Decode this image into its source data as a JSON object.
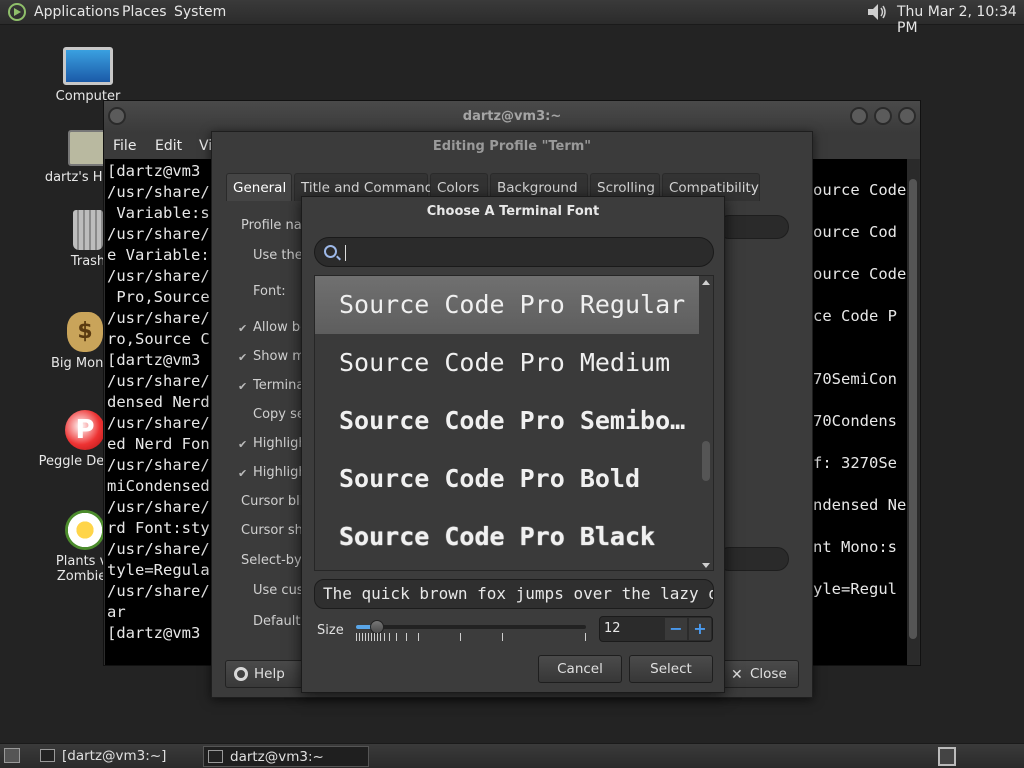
{
  "top_panel": {
    "menus": [
      "Applications",
      "Places",
      "System"
    ],
    "clock": "Thu Mar  2, 10:34 PM"
  },
  "desktop_icons": [
    {
      "label": "Computer",
      "icon": "computer-icon"
    },
    {
      "label": "dartz's Home",
      "icon": "home-folder-icon"
    },
    {
      "label": "Trash",
      "icon": "trash-icon"
    },
    {
      "label": "Big Money",
      "icon": "money-bag-icon"
    },
    {
      "label": "Peggle Deluxe",
      "icon": "peggle-icon"
    },
    {
      "label": "Plants vs Zombies",
      "icon": "plants-icon"
    }
  ],
  "terminal_window": {
    "title": "dartz@vm3:~",
    "menus": [
      "File",
      "Edit",
      "View"
    ],
    "visible_lines": [
      "[dartz@vm3",
      "/usr/share/",
      " Variable:s",
      "/usr/share/",
      "e Variable:",
      "/usr/share/",
      " Pro,Source",
      "/usr/share/",
      "ro,Source C",
      "[dartz@vm3",
      "/usr/share/",
      "densed Nerd",
      "/usr/share/",
      "ed Nerd Fon",
      "/usr/share/",
      "miCondensed",
      "/usr/share/",
      "rd Font:sty",
      "/usr/share/",
      "tyle=Regula",
      "/usr/share/",
      "ar",
      "[dartz@vm3"
    ],
    "right_lines": [
      "ource Code",
      "",
      "ource Cod",
      "",
      "ource Code",
      "",
      "ce Code P",
      "",
      "",
      "70SemiCon",
      "",
      "70Condens",
      "",
      "f: 3270Se",
      "",
      "ndensed Ne",
      "",
      "nt Mono:s",
      "",
      "yle=Regul"
    ]
  },
  "profile_dialog": {
    "title": "Editing Profile \"Term\"",
    "tabs": [
      "General",
      "Title and Command",
      "Colors",
      "Background",
      "Scrolling",
      "Compatibility"
    ],
    "active_tab": "General",
    "labels": {
      "profile_name": "Profile na",
      "use_system_font": "Use the",
      "font": "Font:",
      "allow_bold": "Allow bo",
      "show_menubar": "Show m",
      "terminal_bell": "Termina",
      "copy_selection": "Copy se",
      "highlight1": "Highligh",
      "highlight2": "Highligh",
      "cursor_blink": "Cursor blin",
      "cursor_shape": "Cursor sha",
      "select_by_word": "Select-by-",
      "use_custom": "Use cust",
      "default": "Default"
    },
    "help_label": "Help",
    "close_label": "Close"
  },
  "font_chooser": {
    "title": "Choose A Terminal Font",
    "search_value": "",
    "fonts": [
      {
        "name": "Source Code Pro Regular",
        "weight": "normal",
        "selected": true
      },
      {
        "name": "Source Code Pro Medium",
        "weight": "500",
        "selected": false
      },
      {
        "name": "Source Code Pro Semibold",
        "weight": "600",
        "selected": false
      },
      {
        "name": "Source Code Pro Bold",
        "weight": "bold",
        "selected": false
      },
      {
        "name": "Source Code Pro Black",
        "weight": "900",
        "selected": false
      }
    ],
    "preview_text": "The quick brown fox jumps over the lazy dog",
    "size_label": "Size",
    "size_value": "12",
    "size_slider_fraction": 0.09,
    "cancel_label": "Cancel",
    "select_label": "Select"
  },
  "bottom_panel": {
    "tasks": [
      {
        "label": "[dartz@vm3:~]",
        "active": false
      },
      {
        "label": "dartz@vm3:~",
        "active": true
      }
    ]
  },
  "colors": {
    "accent": "#5aa6e8",
    "panel": "#2f2f2f"
  }
}
